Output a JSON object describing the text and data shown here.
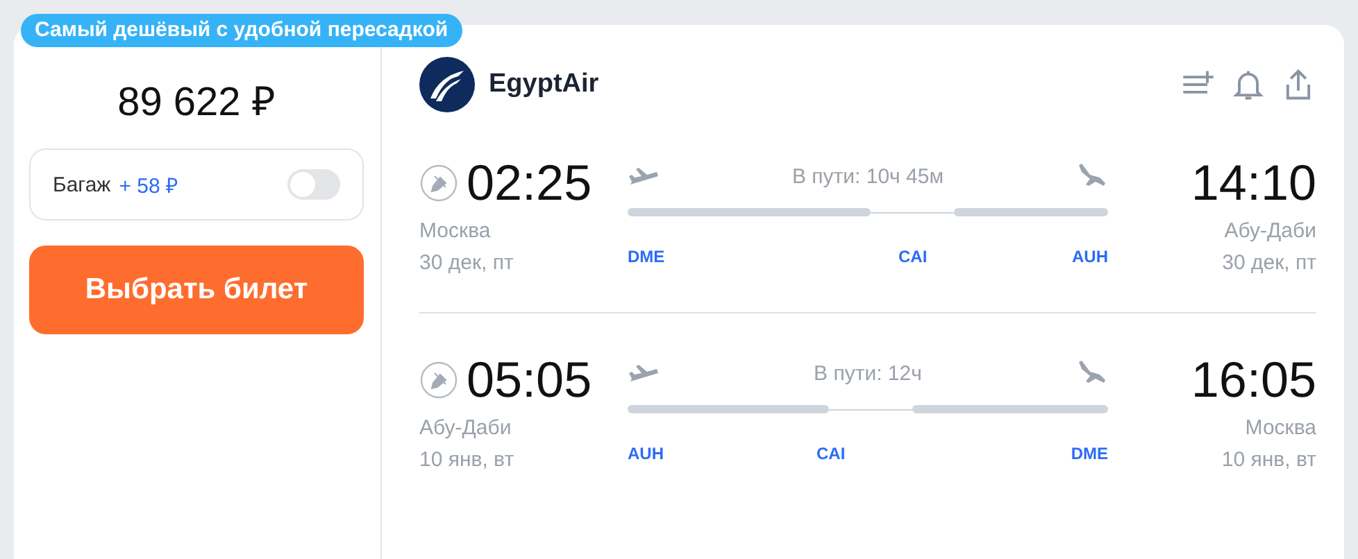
{
  "badge": "Самый дешёвый с удобной пересадкой",
  "price": "89 622 ₽",
  "baggage": {
    "label": "Багаж",
    "extra": "+ 58 ₽",
    "on": false
  },
  "buy_button": "Выбрать билет",
  "airline": {
    "name": "EgyptAir"
  },
  "routes": [
    {
      "depart_time": "02:25",
      "depart_city": "Москва",
      "depart_date": "30 дек, пт",
      "duration": "В пути: 10ч 45м",
      "stops": [
        "DME",
        "CAI",
        "AUH"
      ],
      "arrive_time": "14:10",
      "arrive_city": "Абу-Даби",
      "arrive_date": "30 дек, пт"
    },
    {
      "depart_time": "05:05",
      "depart_city": "Абу-Даби",
      "depart_date": "10 янв, вт",
      "duration": "В пути: 12ч",
      "stops": [
        "AUH",
        "CAI",
        "DME"
      ],
      "arrive_time": "16:05",
      "arrive_city": "Москва",
      "arrive_date": "10 янв, вт"
    }
  ]
}
